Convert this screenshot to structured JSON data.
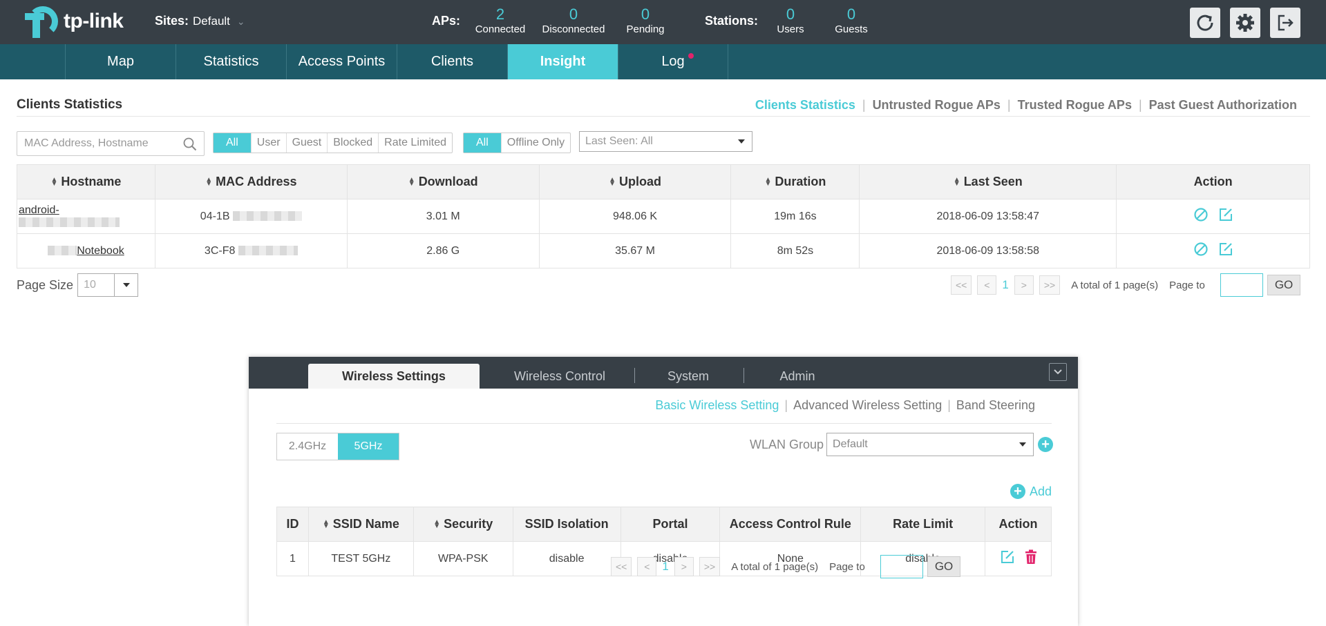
{
  "header": {
    "logo_text": "tp-link",
    "sites_label": "Sites:",
    "sites_value": "Default",
    "aps_label": "APs:",
    "aps": [
      {
        "value": "2",
        "label": "Connected"
      },
      {
        "value": "0",
        "label": "Disconnected"
      },
      {
        "value": "0",
        "label": "Pending"
      }
    ],
    "stations_label": "Stations:",
    "stations": [
      {
        "value": "0",
        "label": "Users"
      },
      {
        "value": "0",
        "label": "Guests"
      }
    ],
    "icons": [
      "refresh-icon",
      "gear-icon",
      "logout-icon"
    ]
  },
  "nav": {
    "items": [
      "Map",
      "Statistics",
      "Access Points",
      "Clients",
      "Insight",
      "Log"
    ],
    "active": "Insight",
    "notification_color": "#e2236b"
  },
  "main": {
    "title": "Clients Statistics",
    "subnav": [
      "Clients Statistics",
      "Untrusted Rogue APs",
      "Trusted Rogue APs",
      "Past Guest Authorization"
    ],
    "search_placeholder": "MAC Address, Hostname",
    "filter_type": [
      "All",
      "User",
      "Guest",
      "Blocked",
      "Rate Limited"
    ],
    "filter_status": [
      "All",
      "Offline Only"
    ],
    "last_seen": "Last Seen: All",
    "columns": [
      "Hostname",
      "MAC Address",
      "Download",
      "Upload",
      "Duration",
      "Last Seen",
      "Action"
    ],
    "rows": [
      {
        "hostname": "android-",
        "mac": "04-1B",
        "download": "3.01 M",
        "upload": "948.06 K",
        "duration": "19m 16s",
        "last_seen": "2018-06-09 13:58:47"
      },
      {
        "hostname": "Notebook",
        "mac": "3C-F8",
        "download": "2.86 G",
        "upload": "35.67 M",
        "duration": "8m 52s",
        "last_seen": "2018-06-09 13:58:58"
      }
    ],
    "page_size_label": "Page Size",
    "page_size_value": "10",
    "pager": {
      "first": "<<",
      "prev": "<",
      "current": "1",
      "next": ">",
      "last": ">>",
      "total": "A total of 1 page(s)",
      "page_to": "Page to",
      "go": "GO"
    }
  },
  "panel": {
    "tabs": [
      "Wireless Settings",
      "Wireless Control",
      "System",
      "Admin"
    ],
    "active_tab": "Wireless Settings",
    "subnav": [
      "Basic Wireless Setting",
      "Advanced Wireless Setting",
      "Band Steering"
    ],
    "bands": [
      "2.4GHz",
      "5GHz"
    ],
    "active_band": "5GHz",
    "wlan_label": "WLAN Group",
    "wlan_value": "Default",
    "add_label": "Add",
    "columns": [
      "ID",
      "SSID Name",
      "Security",
      "SSID Isolation",
      "Portal",
      "Access Control Rule",
      "Rate Limit",
      "Action"
    ],
    "rows": [
      {
        "id": "1",
        "ssid": "TEST 5GHz",
        "security": "WPA-PSK",
        "isolation": "disable",
        "portal": "disable",
        "acl": "None",
        "rate_limit": "disable"
      }
    ],
    "pager": {
      "first": "<<",
      "prev": "<",
      "current": "1",
      "next": ">",
      "last": ">>",
      "total": "A total of 1 page(s)",
      "page_to": "Page to",
      "go": "GO"
    }
  },
  "colors": {
    "accent": "#4acbd6",
    "header": "#373f46",
    "nav": "#1e5a68",
    "danger": "#e2236b"
  }
}
